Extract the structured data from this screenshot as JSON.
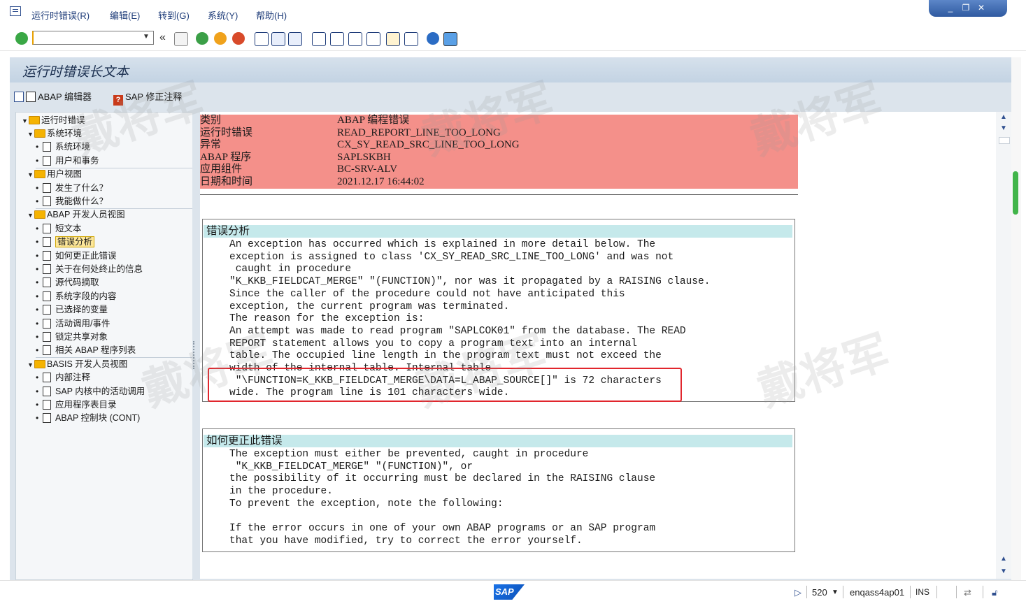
{
  "menu": {
    "items": [
      "运行时错误(R)",
      "编辑(E)",
      "转到(G)",
      "系统(Y)",
      "帮助(H)"
    ]
  },
  "window_controls": [
    "_",
    "❐",
    "✕"
  ],
  "toolbar": {
    "command_field_value": "",
    "back_glyph": "«"
  },
  "page": {
    "title": "运行时错误长文本"
  },
  "app_toolbar": {
    "abap_editor": "ABAP 编辑器",
    "sap_note": "SAP 修正注释",
    "note_icon_glyph": "?"
  },
  "tree": {
    "root": "运行时错误",
    "nodes": [
      {
        "label": "系统环境",
        "type": "folder",
        "level": 1
      },
      {
        "label": "系统环境",
        "type": "doc",
        "level": 2
      },
      {
        "label": "用户和事务",
        "type": "doc",
        "level": 2
      },
      {
        "label": "用户视图",
        "type": "folder",
        "level": 1
      },
      {
        "label": "发生了什么？",
        "type": "doc",
        "level": 2
      },
      {
        "label": "我能做什么？",
        "type": "doc",
        "level": 2
      },
      {
        "label": "ABAP 开发人员视图",
        "type": "folder",
        "level": 1
      },
      {
        "label": "短文本",
        "type": "doc",
        "level": 2
      },
      {
        "label": "错误分析",
        "type": "doc",
        "level": 2,
        "selected": true
      },
      {
        "label": "如何更正此错误",
        "type": "doc",
        "level": 2
      },
      {
        "label": "关于在何处终止的信息",
        "type": "doc",
        "level": 2
      },
      {
        "label": "源代码摘取",
        "type": "doc",
        "level": 2
      },
      {
        "label": "系统字段的内容",
        "type": "doc",
        "level": 2
      },
      {
        "label": "已选择的变量",
        "type": "doc",
        "level": 2
      },
      {
        "label": "活动调用/事件",
        "type": "doc",
        "level": 2
      },
      {
        "label": "锁定共享对象",
        "type": "doc",
        "level": 2
      },
      {
        "label": "相关 ABAP 程序列表",
        "type": "doc",
        "level": 2
      },
      {
        "label": "BASIS 开发人员视图",
        "type": "folder",
        "level": 1
      },
      {
        "label": "内部注释",
        "type": "doc",
        "level": 2
      },
      {
        "label": "SAP 内核中的活动调用",
        "type": "doc",
        "level": 2
      },
      {
        "label": "应用程序表目录",
        "type": "doc",
        "level": 2
      },
      {
        "label": "ABAP 控制块 (CONT)",
        "type": "doc",
        "level": 2
      }
    ]
  },
  "header": {
    "rows": [
      {
        "key": "类别",
        "value": "ABAP  编程错误"
      },
      {
        "key": "运行时错误",
        "value": "READ_REPORT_LINE_TOO_LONG"
      },
      {
        "key": "异常",
        "value": "CX_SY_READ_SRC_LINE_TOO_LONG"
      },
      {
        "key": "ABAP  程序",
        "value": "SAPLSKBH"
      },
      {
        "key": "应用组件",
        "value": "BC-SRV-ALV"
      },
      {
        "key": "日期和时间",
        "value": "2021.12.17  16:44:02"
      }
    ]
  },
  "error_analysis": {
    "title": "错误分析",
    "lines": [
      "An exception has occurred which is explained in more detail below. The",
      "exception is assigned to class 'CX_SY_READ_SRC_LINE_TOO_LONG' and was not",
      " caught in procedure",
      "\"K_KKB_FIELDCAT_MERGE\" \"(FUNCTION)\", nor was it propagated by a RAISING clause.",
      "Since the caller of the procedure could not have anticipated this",
      "exception, the current program was terminated.",
      "The reason for the exception is:",
      "An attempt was made to read program \"SAPLCOK01\" from the database. The READ",
      "REPORT statement allows you to copy a program text into an internal",
      "table. The occupied line length in the program text must not exceed the",
      "width of the internal table. Internal table",
      " \"\\FUNCTION=K_KKB_FIELDCAT_MERGE\\DATA=L_ABAP_SOURCE[]\" is 72 characters",
      "wide. The program line is 101 characters wide."
    ]
  },
  "how_to_fix": {
    "title": "如何更正此错误",
    "lines": [
      "The exception must either be prevented, caught in procedure",
      " \"K_KKB_FIELDCAT_MERGE\" \"(FUNCTION)\", or",
      "the possibility of it occurring must be declared in the RAISING clause",
      "in the procedure.",
      "To prevent the exception, note the following:",
      "",
      "If the error occurs in one of your own ABAP programs or an SAP program",
      "that you have modified, try to correct the error yourself."
    ]
  },
  "status_bar": {
    "sap_logo": "SAP",
    "client": "520",
    "server": "enqass4ap01",
    "mode": "INS"
  },
  "watermark_text": "戴将军",
  "colors": {
    "header_bg": "#f4908a",
    "section_title_bg": "#c5e9eb",
    "highlight_border": "#e1262d",
    "frame_bg": "#dce4ec",
    "selected_bg": "#fde79a"
  }
}
